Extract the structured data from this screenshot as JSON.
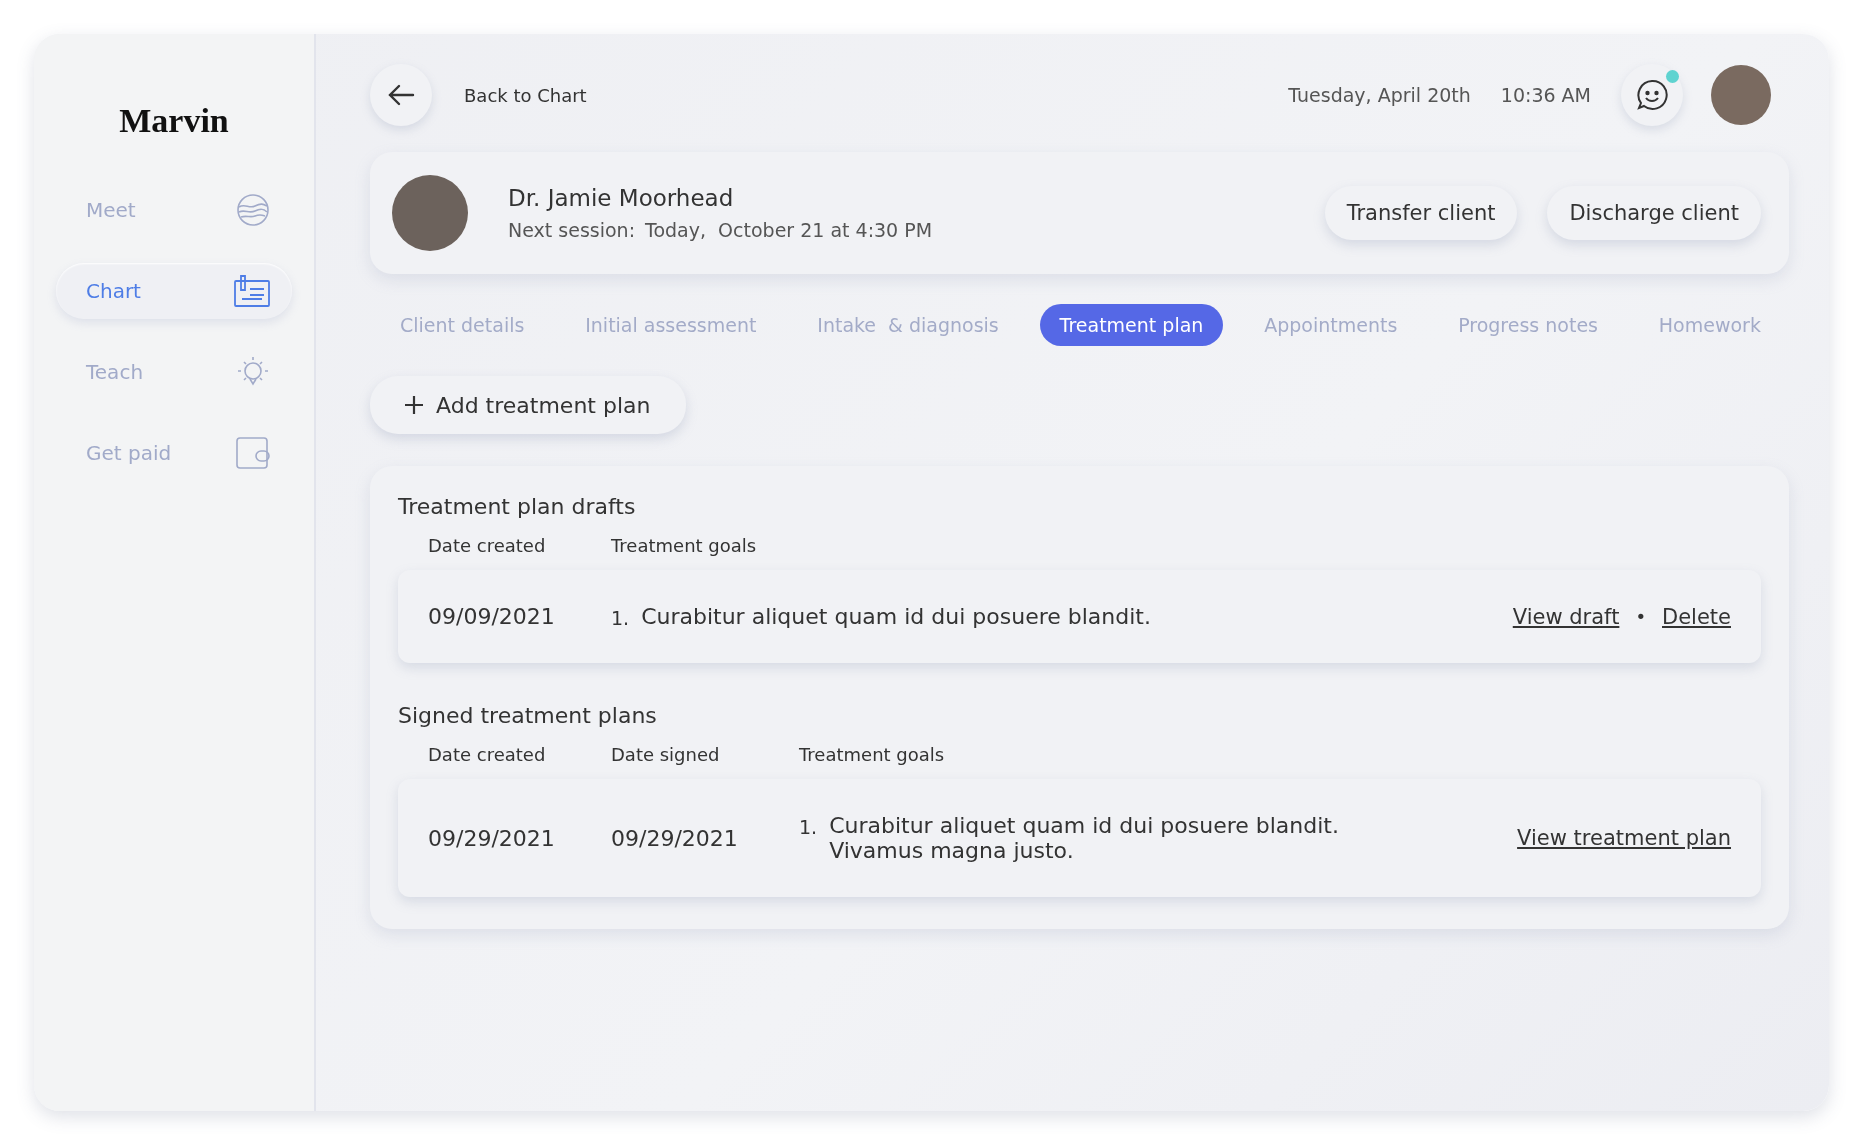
{
  "sidebar": {
    "logo": "Marvin",
    "items": [
      {
        "label": "Meet",
        "selected": false
      },
      {
        "label": "Chart",
        "selected": true
      },
      {
        "label": "Teach",
        "selected": false
      },
      {
        "label": "Get paid",
        "selected": false
      }
    ]
  },
  "header": {
    "back_label": "Back to Chart",
    "date": "Tuesday, April 20th",
    "time": "10:36 AM",
    "messages_unread": true
  },
  "client": {
    "name": "Dr. Jamie Moorhead",
    "next_session_label": "Next session:",
    "next_session": "Today,  October 21 at 4:30 PM",
    "buttons": [
      "Transfer client",
      "Discharge client"
    ]
  },
  "tabs": [
    {
      "label": "Client details",
      "selected": false
    },
    {
      "label": "Initial assessment",
      "selected": false
    },
    {
      "label": "Intake  & diagnosis",
      "selected": false
    },
    {
      "label": "Treatment plan",
      "selected": true
    },
    {
      "label": "Appointments",
      "selected": false
    },
    {
      "label": "Progress notes",
      "selected": false
    },
    {
      "label": "Homework",
      "selected": false
    }
  ],
  "add_button": "Add treatment plan",
  "drafts": {
    "title": "Treatment plan drafts",
    "columns": [
      "Date created",
      "Treatment goals"
    ],
    "rows": [
      {
        "date_created": "09/09/2021",
        "goals": [
          {
            "number": "1.",
            "text": "Curabitur aliquet quam id dui posuere blandit."
          }
        ],
        "actions": [
          "View draft",
          "Delete"
        ],
        "separator": "•"
      }
    ]
  },
  "signed": {
    "title": "Signed treatment plans",
    "columns": [
      "Date created",
      "Date signed",
      "Treatment goals"
    ],
    "rows": [
      {
        "date_created": "09/29/2021",
        "date_signed": "09/29/2021",
        "goals": [
          {
            "number": "1.",
            "text": "Curabitur aliquet quam id dui posuere blandit. Vivamus magna justo."
          }
        ],
        "actions": [
          "View treatment plan"
        ]
      }
    ]
  }
}
